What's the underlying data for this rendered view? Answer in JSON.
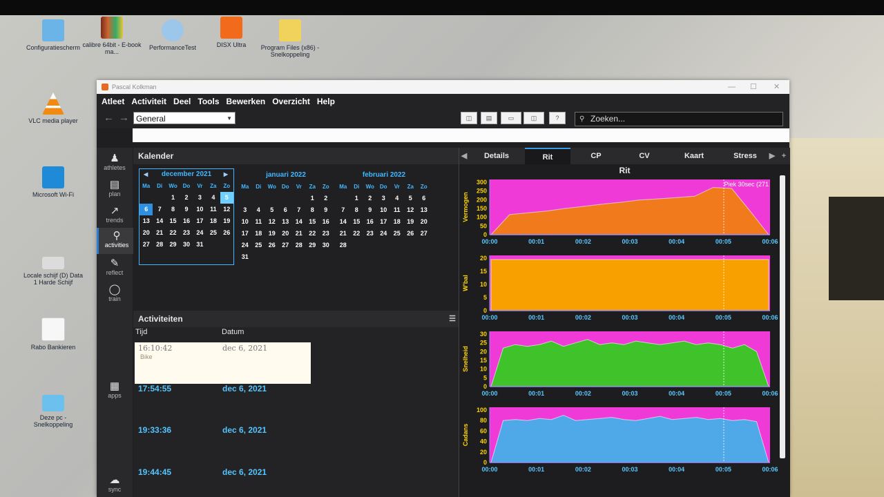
{
  "desktop": {
    "icons": [
      {
        "label": "Configuratiescherm"
      },
      {
        "label": "calibre 64bit - E-book ma..."
      },
      {
        "label": "PerformanceTest"
      },
      {
        "label": "DISX Ultra"
      },
      {
        "label": "Program Files (x86) - Snelkoppeling"
      },
      {
        "label": "VLC media player"
      },
      {
        "label": "Microsoft Wi-Fi"
      },
      {
        "label": "Locale schijf (D) Data 1 Harde Schijf"
      },
      {
        "label": "Rabo Bankieren"
      },
      {
        "label": "Deze pc - Snelkoppeling"
      }
    ]
  },
  "window": {
    "title": "Pascal Kolkman",
    "menu": [
      "Atleet",
      "Activiteit",
      "Deel",
      "Tools",
      "Bewerken",
      "Overzicht",
      "Help"
    ],
    "workspace": "General",
    "search_placeholder": "Zoeken..."
  },
  "sidebar": [
    {
      "label": "athletes",
      "icon": "athletes-icon"
    },
    {
      "label": "plan",
      "icon": "plan-icon"
    },
    {
      "label": "trends",
      "icon": "trends-icon"
    },
    {
      "label": "activities",
      "icon": "activities-icon",
      "active": true
    },
    {
      "label": "reflect",
      "icon": "reflect-icon"
    },
    {
      "label": "train",
      "icon": "train-icon"
    },
    {
      "label": "apps",
      "icon": "apps-icon"
    },
    {
      "label": "sync",
      "icon": "sync-icon"
    }
  ],
  "calendar": {
    "title": "Kalender",
    "weekdays": [
      "Ma",
      "Di",
      "Wo",
      "Do",
      "Vr",
      "Za",
      "Zo"
    ],
    "months": [
      {
        "name": "december 2021",
        "first_weekday_index": 2,
        "days": 31,
        "today": 6,
        "selected": 5
      },
      {
        "name": "januari 2022",
        "first_weekday_index": 5,
        "days": 31
      },
      {
        "name": "februari 2022",
        "first_weekday_index": 1,
        "days": 28
      }
    ]
  },
  "activities": {
    "title": "Activiteiten",
    "columns": [
      "Tijd",
      "Datum"
    ],
    "selected": {
      "time": "16:10:42",
      "date": "dec 6, 2021",
      "sport": "Bike"
    },
    "rows": [
      {
        "time": "17:54:55",
        "date": "dec 6, 2021"
      },
      {
        "time": "19:33:36",
        "date": "dec 6, 2021"
      },
      {
        "time": "19:44:45",
        "date": "dec 6, 2021"
      }
    ]
  },
  "ride": {
    "tabs": [
      "Details",
      "Rit",
      "CP",
      "CV",
      "Kaart",
      "Stress"
    ],
    "active_tab": "Rit",
    "title": "Rit"
  },
  "colors": {
    "background_band": "#f03ad8",
    "accent": "#41b8ff"
  },
  "chart_data": [
    {
      "type": "area",
      "ylabel": "Vermogen",
      "ylim": [
        0,
        300
      ],
      "yticks": [
        0,
        50,
        100,
        150,
        200,
        250,
        300
      ],
      "color": "#f07a1c",
      "x": [
        "00:00",
        "00:01",
        "00:02",
        "00:03",
        "00:04",
        "00:05",
        "00:06"
      ],
      "xticks": [
        "00:00",
        "00:01",
        "00:02",
        "00:03",
        "00:04",
        "00:05",
        "00:06"
      ],
      "annotation": "Piek 30sec (271",
      "values": [
        0,
        115,
        125,
        135,
        150,
        162,
        175,
        185,
        198,
        205,
        212,
        220,
        270,
        265,
        135,
        0
      ]
    },
    {
      "type": "area",
      "ylabel": "W'bal",
      "ylim": [
        0,
        20
      ],
      "yticks": [
        0,
        5,
        10,
        15,
        20
      ],
      "color": "#f7a000",
      "xticks": [
        "00:00",
        "00:01",
        "00:02",
        "00:03",
        "00:04",
        "00:05",
        "00:06"
      ],
      "values": [
        19.5,
        19.5,
        19.5,
        19.5,
        19.5,
        19.5,
        19.5,
        19.5
      ]
    },
    {
      "type": "area",
      "ylabel": "Snelheid",
      "ylim": [
        0,
        30
      ],
      "yticks": [
        0,
        5,
        10,
        15,
        20,
        25,
        30
      ],
      "color": "#3fc22a",
      "xticks": [
        "00:00",
        "00:01",
        "00:02",
        "00:03",
        "00:04",
        "00:05",
        "00:06"
      ],
      "values": [
        0,
        22,
        24,
        23,
        24,
        26,
        23,
        25,
        27,
        24,
        25,
        24,
        26,
        25,
        24,
        25,
        26,
        24,
        25,
        24,
        22,
        24,
        20,
        0
      ]
    },
    {
      "type": "area",
      "ylabel": "Cadans",
      "ylim": [
        0,
        100
      ],
      "yticks": [
        0,
        20,
        40,
        60,
        80,
        100
      ],
      "color": "#4fa8e8",
      "xticks": [
        "00:00",
        "00:01",
        "00:02",
        "00:03",
        "00:04",
        "00:05",
        "00:06"
      ],
      "values": [
        0,
        80,
        82,
        80,
        84,
        82,
        90,
        80,
        82,
        84,
        86,
        82,
        80,
        84,
        88,
        82,
        84,
        86,
        82,
        84,
        80,
        82,
        78,
        0
      ]
    }
  ]
}
